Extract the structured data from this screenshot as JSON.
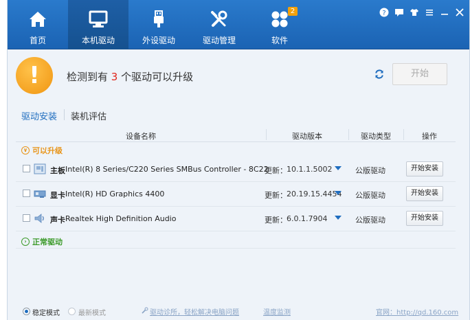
{
  "nav": {
    "tabs": [
      {
        "label": "首页",
        "icon": "home-icon"
      },
      {
        "label": "本机驱动",
        "icon": "monitor-icon",
        "active": true
      },
      {
        "label": "外设驱动",
        "icon": "usb-icon"
      },
      {
        "label": "驱动管理",
        "icon": "tools-icon"
      },
      {
        "label": "软件",
        "icon": "apps-icon",
        "badge": "2"
      }
    ],
    "window_controls": [
      "help-icon",
      "feedback-icon",
      "skin-icon",
      "menu-icon",
      "minimize-icon",
      "close-icon"
    ]
  },
  "status": {
    "alert_glyph": "!",
    "text_before": "检测到有 ",
    "count": "3",
    "text_after": " 个驱动可以升级",
    "start_label": "开始"
  },
  "subtabs": [
    {
      "label": "驱动安装",
      "active": true
    },
    {
      "label": "装机评估"
    }
  ],
  "table": {
    "headers": [
      "设备名称",
      "驱动版本",
      "驱动类型",
      "操作"
    ],
    "group_upgradable": {
      "glyph": "∨",
      "label": "可以升级"
    },
    "rows": [
      {
        "type": "主板",
        "name": "Intel(R) 8 Series/C220 Series SMBus Controller - 8C22",
        "version_label": "更新：",
        "version": "10.1.1.5002",
        "driver_type": "公版驱动",
        "action": "开始安装",
        "icon": "motherboard-icon"
      },
      {
        "type": "显卡",
        "name": "Intel(R) HD Graphics 4400",
        "version_label": "更新：",
        "version": "20.19.15.4454",
        "driver_type": "公版驱动",
        "action": "开始安装",
        "icon": "graphics-card-icon"
      },
      {
        "type": "声卡",
        "name": "Realtek High Definition Audio",
        "version_label": "更新：",
        "version": "6.0.1.7904",
        "driver_type": "公版驱动",
        "action": "开始安装",
        "icon": "speaker-icon"
      }
    ],
    "group_normal": {
      "glyph": "›",
      "label": "正常驱动"
    }
  },
  "footer": {
    "mode_stable": "稳定模式",
    "mode_latest": "最新模式",
    "link_diag": "驱动诊所，轻松解决电脑问题",
    "link_temp": "温度监测",
    "link_site": "官网：http://qd.160.com"
  }
}
